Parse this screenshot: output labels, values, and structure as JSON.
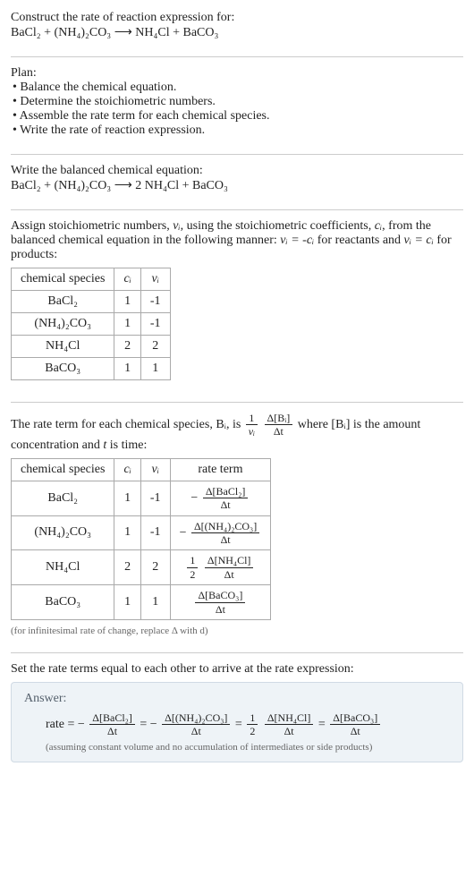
{
  "header": {
    "title": "Construct the rate of reaction expression for:",
    "equation": "BaCl₂ + (NH₄)₂CO₃ ⟶ NH₄Cl + BaCO₃"
  },
  "plan": {
    "label": "Plan:",
    "items": [
      "• Balance the chemical equation.",
      "• Determine the stoichiometric numbers.",
      "• Assemble the rate term for each chemical species.",
      "• Write the rate of reaction expression."
    ]
  },
  "balanced": {
    "label": "Write the balanced chemical equation:",
    "equation": "BaCl₂ + (NH₄)₂CO₃ ⟶ 2 NH₄Cl + BaCO₃"
  },
  "stoich": {
    "intro_parts": {
      "p1": "Assign stoichiometric numbers, ",
      "nu_i": "νᵢ",
      "p2": ", using the stoichiometric coefficients, ",
      "c_i": "cᵢ",
      "p3": ", from the balanced chemical equation in the following manner: ",
      "eq1": "νᵢ = -cᵢ",
      "p4": " for reactants and ",
      "eq2": "νᵢ = cᵢ",
      "p5": " for products:"
    },
    "table": {
      "headers": [
        "chemical species",
        "cᵢ",
        "νᵢ"
      ],
      "rows": [
        [
          "BaCl₂",
          "1",
          "-1"
        ],
        [
          "(NH₄)₂CO₃",
          "1",
          "-1"
        ],
        [
          "NH₄Cl",
          "2",
          "2"
        ],
        [
          "BaCO₃",
          "1",
          "1"
        ]
      ]
    }
  },
  "rateterm": {
    "intro": {
      "p1": "The rate term for each chemical species, Bᵢ, is ",
      "frac1_num": "1",
      "frac1_den": "νᵢ",
      "frac2_num": "Δ[Bᵢ]",
      "frac2_den": "Δt",
      "p2": " where [Bᵢ] is the amount concentration and ",
      "t": "t",
      "p3": " is time:"
    },
    "table": {
      "headers": [
        "chemical species",
        "cᵢ",
        "νᵢ",
        "rate term"
      ],
      "rows": [
        {
          "species": "BaCl₂",
          "c": "1",
          "nu": "-1",
          "rt": {
            "neg": true,
            "half": false,
            "num": "Δ[BaCl₂]",
            "den": "Δt"
          }
        },
        {
          "species": "(NH₄)₂CO₃",
          "c": "1",
          "nu": "-1",
          "rt": {
            "neg": true,
            "half": false,
            "num": "Δ[(NH₄)₂CO₃]",
            "den": "Δt"
          }
        },
        {
          "species": "NH₄Cl",
          "c": "2",
          "nu": "2",
          "rt": {
            "neg": false,
            "half": true,
            "num": "Δ[NH₄Cl]",
            "den": "Δt"
          }
        },
        {
          "species": "BaCO₃",
          "c": "1",
          "nu": "1",
          "rt": {
            "neg": false,
            "half": false,
            "num": "Δ[BaCO₃]",
            "den": "Δt"
          }
        }
      ]
    },
    "caption": "(for infinitesimal rate of change, replace Δ with d)"
  },
  "final": {
    "intro": "Set the rate terms equal to each other to arrive at the rate expression:",
    "answer_label": "Answer:",
    "rate_prefix": "rate = ",
    "terms": [
      {
        "neg": true,
        "half": false,
        "num": "Δ[BaCl₂]",
        "den": "Δt"
      },
      {
        "neg": true,
        "half": false,
        "num": "Δ[(NH₄)₂CO₃]",
        "den": "Δt"
      },
      {
        "neg": false,
        "half": true,
        "num": "Δ[NH₄Cl]",
        "den": "Δt"
      },
      {
        "neg": false,
        "half": false,
        "num": "Δ[BaCO₃]",
        "den": "Δt"
      }
    ],
    "note": "(assuming constant volume and no accumulation of intermediates or side products)"
  },
  "chart_data": {
    "type": "table",
    "tables": [
      {
        "title": "Stoichiometric numbers",
        "columns": [
          "chemical species",
          "c_i",
          "nu_i"
        ],
        "rows": [
          [
            "BaCl2",
            1,
            -1
          ],
          [
            "(NH4)2CO3",
            1,
            -1
          ],
          [
            "NH4Cl",
            2,
            2
          ],
          [
            "BaCO3",
            1,
            1
          ]
        ]
      },
      {
        "title": "Rate terms",
        "columns": [
          "chemical species",
          "c_i",
          "nu_i",
          "rate term"
        ],
        "rows": [
          [
            "BaCl2",
            1,
            -1,
            "-Δ[BaCl2]/Δt"
          ],
          [
            "(NH4)2CO3",
            1,
            -1,
            "-Δ[(NH4)2CO3]/Δt"
          ],
          [
            "NH4Cl",
            2,
            2,
            "(1/2)Δ[NH4Cl]/Δt"
          ],
          [
            "BaCO3",
            1,
            1,
            "Δ[BaCO3]/Δt"
          ]
        ]
      }
    ]
  }
}
